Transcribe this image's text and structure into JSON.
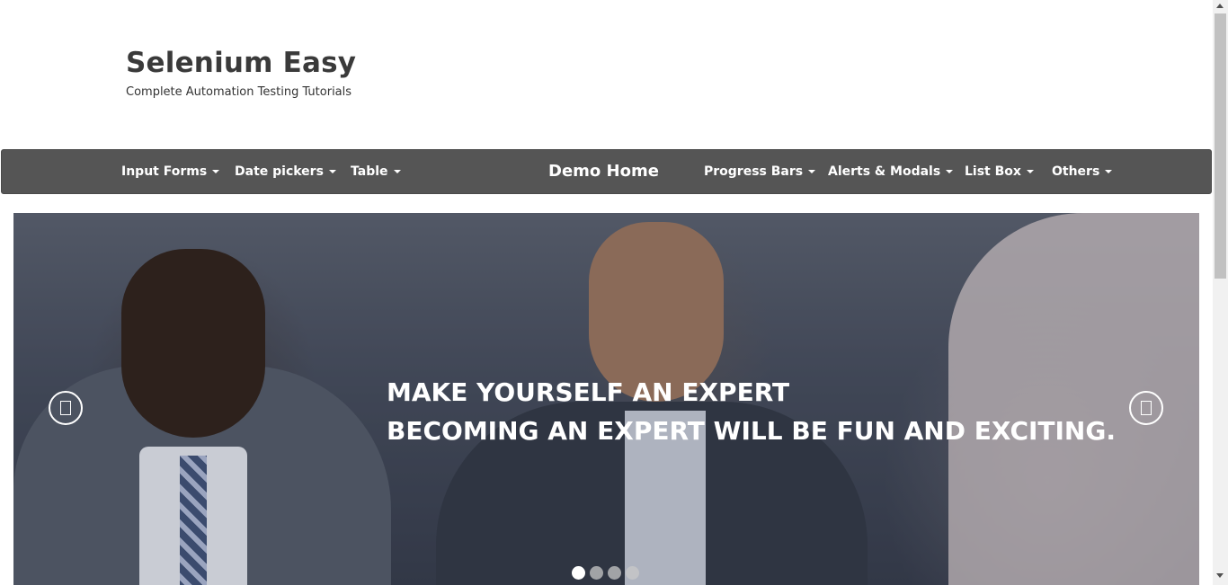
{
  "site": {
    "title": "Selenium Easy",
    "tagline": "Complete Automation Testing Tutorials"
  },
  "nav": {
    "items": [
      {
        "label": "Input Forms"
      },
      {
        "label": "Date pickers"
      },
      {
        "label": "Table"
      },
      {
        "label": "Progress Bars"
      },
      {
        "label": "Alerts & Modals"
      },
      {
        "label": "List Box"
      },
      {
        "label": "Others"
      }
    ],
    "home": "Demo Home"
  },
  "carousel": {
    "caption_line1": "MAKE YOURSELF AN EXPERT",
    "caption_line2": "BECOMING AN EXPERT WILL BE FUN AND EXCITING.",
    "slide_count": 4,
    "active_slide": 1
  },
  "colors": {
    "navbar": "#555555",
    "caption_text": "#ffffff"
  }
}
